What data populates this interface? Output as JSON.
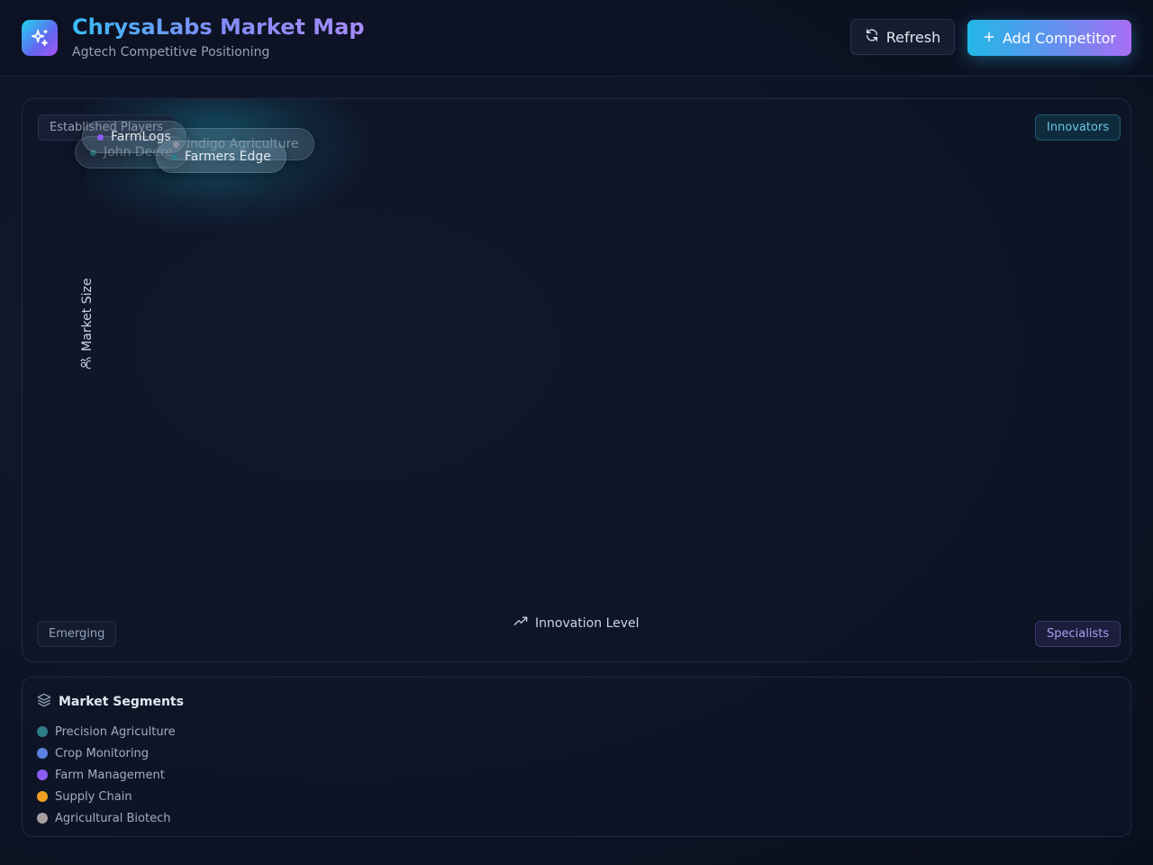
{
  "header": {
    "title": "ChrysaLabs Market Map",
    "subtitle": "Agtech Competitive Positioning",
    "logo_icon": "sparkles-icon",
    "refresh_label": "Refresh",
    "add_label": "Add Competitor",
    "accent_gradient": [
      "#22b8e6",
      "#6b8cf0",
      "#a86ef5"
    ]
  },
  "map": {
    "quadrants": {
      "top_left": "Established Players",
      "top_right": "Innovators",
      "bottom_left": "Emerging",
      "bottom_right": "Specialists"
    },
    "y_axis_label": "Market Size",
    "x_axis_label": "Innovation Level",
    "competitors": [
      {
        "name": "John Deere",
        "segment": "Precision Agriculture",
        "color": "#2f7c86"
      },
      {
        "name": "FarmLogs",
        "segment": "Farm Management",
        "color": "#8b5cf6"
      },
      {
        "name": "Indigo Agriculture",
        "segment": "Agricultural Biotech",
        "color": "#a8a0a0"
      },
      {
        "name": "Farmers Edge",
        "segment": "Precision Agriculture",
        "color": "#2f7c86"
      }
    ]
  },
  "legend": {
    "title": "Market Segments",
    "items": [
      {
        "label": "Precision Agriculture",
        "color": "#2f7c86"
      },
      {
        "label": "Crop Monitoring",
        "color": "#5b82e0"
      },
      {
        "label": "Farm Management",
        "color": "#8b5cf6"
      },
      {
        "label": "Supply Chain",
        "color": "#f0a020"
      },
      {
        "label": "Agricultural Biotech",
        "color": "#a8a0a0"
      }
    ]
  }
}
